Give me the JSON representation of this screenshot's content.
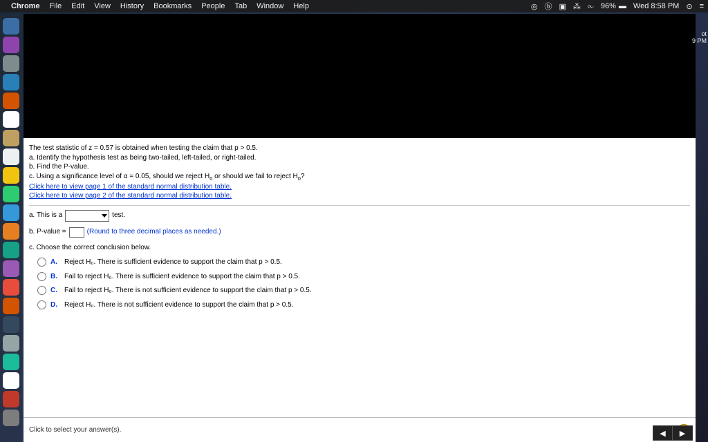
{
  "menubar": {
    "app": "Chrome",
    "items": [
      "File",
      "Edit",
      "View",
      "History",
      "Bookmarks",
      "People",
      "Tab",
      "Window",
      "Help"
    ],
    "battery": "96%",
    "clock": "Wed 8:58 PM"
  },
  "sidenote": {
    "l1": "ot",
    "l2": "9 PM"
  },
  "question": {
    "intro": "The test statistic of z = 0.57 is obtained when testing the claim that p > 0.5.",
    "a": "a. Identify the hypothesis test as being two-tailed, left-tailed, or right-tailed.",
    "b": "b. Find the P-value.",
    "c_pre": "c. Using a significance level of α = 0.05, should we reject H",
    "c_mid": " or should we fail to reject H",
    "c_end": "?",
    "link1": "Click here to view page 1 of the standard normal distribution table.",
    "link2": "Click here to view page 2 of the standard normal distribution table.",
    "ans_a_pre": "a. This is a",
    "ans_a_post": "test.",
    "ans_b_pre": "b. P-value =",
    "ans_b_hint": "(Round to three decimal places as needed.)",
    "ans_c_title": "c. Choose the correct conclusion below.",
    "choiceA": "Reject H₀. There is sufficient evidence to support the claim that p > 0.5.",
    "choiceB": "Fail to reject H₀. There is sufficient evidence to support the claim that p > 0.5.",
    "choiceC": "Fail to reject H₀. There is not sufficient evidence to support the claim that p > 0.5.",
    "choiceD": "Reject H₀. There is not sufficient evidence to support the claim that p > 0.5.",
    "letters": {
      "A": "A.",
      "B": "B.",
      "C": "C.",
      "D": "D."
    }
  },
  "footer": {
    "hint": "Click to select your answer(s).",
    "help": "?"
  },
  "dock_colors": [
    "#3b6ea5",
    "#8e44ad",
    "#7f8c8d",
    "#2980b9",
    "#d35400",
    "#ffffff",
    "#c0a060",
    "#ecf0f1",
    "#f1c40f",
    "#2ecc71",
    "#3498db",
    "#e67e22",
    "#16a085",
    "#9b59b6",
    "#e74c3c",
    "#d35400",
    "#34495e",
    "#95a5a6",
    "#1abc9c",
    "#ffffff",
    "#c0392b",
    "#7d7d7d"
  ]
}
